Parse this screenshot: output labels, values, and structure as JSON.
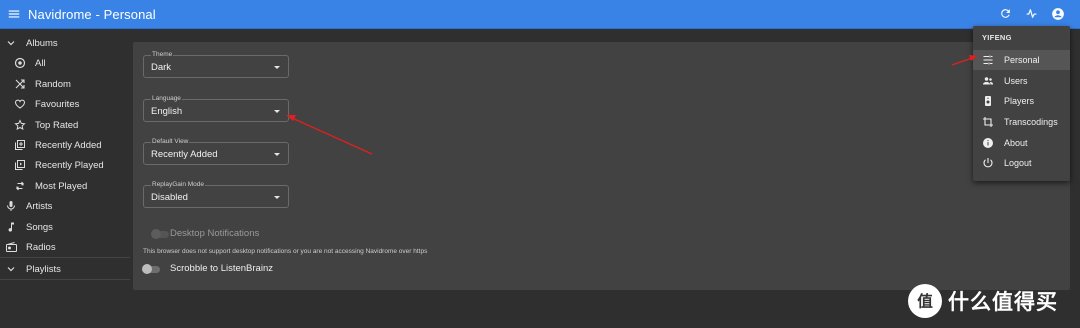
{
  "app": {
    "title": "Navidrome - Personal"
  },
  "appbar_icons": [
    "refresh-icon",
    "activity-icon",
    "account-circle-icon"
  ],
  "sidebar": {
    "albums": {
      "label": "Albums",
      "icon": "chevron-down-icon"
    },
    "album_items": [
      {
        "label": "All",
        "icon": "disc-icon"
      },
      {
        "label": "Random",
        "icon": "shuffle-icon"
      },
      {
        "label": "Favourites",
        "icon": "heart-icon"
      },
      {
        "label": "Top Rated",
        "icon": "star-icon"
      },
      {
        "label": "Recently Added",
        "icon": "library-add-icon"
      },
      {
        "label": "Recently Played",
        "icon": "library-play-icon"
      },
      {
        "label": "Most Played",
        "icon": "repeat-icon"
      }
    ],
    "artists": {
      "label": "Artists",
      "icon": "mic-icon"
    },
    "songs": {
      "label": "Songs",
      "icon": "music-note-icon"
    },
    "radios": {
      "label": "Radios",
      "icon": "radio-icon"
    },
    "playlists": {
      "label": "Playlists",
      "icon": "chevron-down-icon"
    }
  },
  "settings": {
    "theme": {
      "label": "Theme",
      "value": "Dark"
    },
    "language": {
      "label": "Language",
      "value": "English"
    },
    "default_view": {
      "label": "Default View",
      "value": "Recently Added"
    },
    "replaygain": {
      "label": "ReplayGain Mode",
      "value": "Disabled"
    },
    "desktop_notifications": {
      "label": "Desktop Notifications",
      "enabled": false,
      "disabled": true
    },
    "notification_helper": "This browser does not support desktop notifications or you are not accessing Navidrome over https",
    "scrobble": {
      "label": "Scrobble to ListenBrainz",
      "enabled": false
    }
  },
  "user_menu": {
    "username": "YIFENG",
    "items": [
      {
        "label": "Personal",
        "icon": "tune-icon",
        "selected": true
      },
      {
        "label": "Users",
        "icon": "people-icon"
      },
      {
        "label": "Players",
        "icon": "speaker-icon"
      },
      {
        "label": "Transcodings",
        "icon": "crop-icon"
      },
      {
        "label": "About",
        "icon": "info-icon"
      },
      {
        "label": "Logout",
        "icon": "power-icon"
      }
    ]
  },
  "watermark": {
    "text": "什么值得买",
    "icon": "zhi-logo-icon"
  },
  "colors": {
    "appbar": "#3a83e6",
    "background": "#2f2f2f",
    "card": "#424242",
    "annotation_arrow": "#e02020"
  }
}
